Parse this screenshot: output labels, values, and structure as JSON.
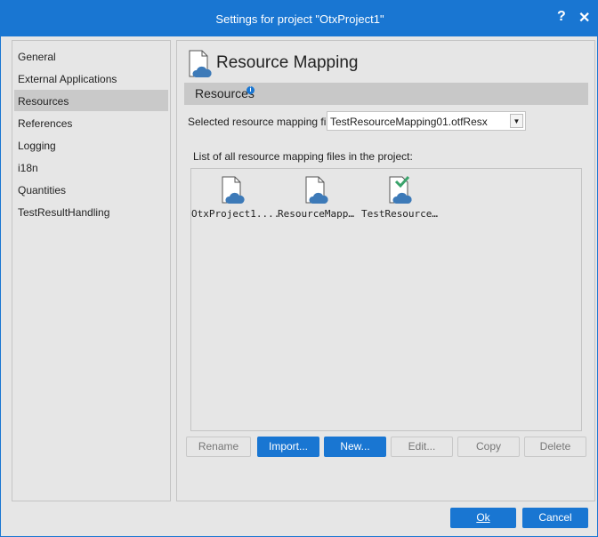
{
  "window": {
    "title": "Settings for project \"OtxProject1\"",
    "help": "?",
    "close": "✕"
  },
  "sidebar": {
    "items": [
      {
        "label": "General"
      },
      {
        "label": "External Applications"
      },
      {
        "label": "Resources",
        "selected": true
      },
      {
        "label": "References"
      },
      {
        "label": "Logging"
      },
      {
        "label": "i18n"
      },
      {
        "label": "Quantities"
      },
      {
        "label": "TestResultHandling"
      }
    ]
  },
  "main": {
    "title": "Resource Mapping",
    "section": "Resources",
    "selected_label": "Selected resource mapping file",
    "selected_value": "TestResourceMapping01.otfResx",
    "list_label": "List of all resource mapping files in the project:",
    "files": [
      {
        "name": "OtxProject1....",
        "active": false
      },
      {
        "name": "ResourceMapp…",
        "active": false
      },
      {
        "name": "TestResource…",
        "active": true
      }
    ],
    "buttons": {
      "rename": "Rename",
      "import": "Import...",
      "new": "New...",
      "edit": "Edit...",
      "copy": "Copy",
      "delete": "Delete"
    }
  },
  "footer": {
    "ok": "Ok",
    "cancel": "Cancel"
  },
  "colors": {
    "accent": "#1976d2",
    "cloud": "#3d7ab8",
    "check": "#3aa36b"
  }
}
